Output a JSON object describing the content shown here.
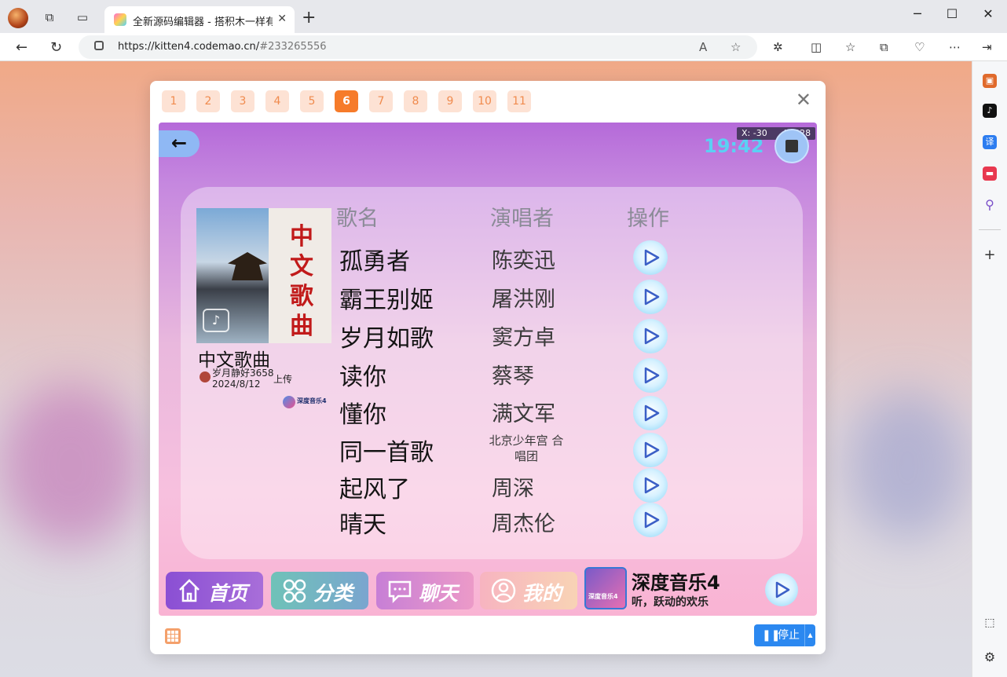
{
  "browser": {
    "tab_title": "全新源码编辑器 - 搭积木一样有趣",
    "tab_close": "✕",
    "new_tab": "+",
    "url_host": "https://kitten4.codemao.cn/",
    "url_hash": "#233265556",
    "icons": [
      "profile-icon",
      "workspaces-icon",
      "tab-actions-icon",
      "back-icon",
      "refresh-icon",
      "lock-icon",
      "read-aloud-icon",
      "favorite-icon",
      "extensions-icon",
      "split-screen-icon",
      "favorites-icon",
      "collections-icon",
      "performance-icon",
      "more-icon",
      "sidebar-toggle-icon"
    ]
  },
  "sidebar": {
    "icons": [
      "toolbox-icon",
      "tiktok-icon",
      "translate-icon",
      "app-icon",
      "search-icon",
      "add-icon",
      "screenshot-icon",
      "settings-icon"
    ],
    "translate_label": "译"
  },
  "modal": {
    "screens": [
      "1",
      "2",
      "3",
      "4",
      "5",
      "6",
      "7",
      "8",
      "9",
      "10",
      "11"
    ],
    "active_screen": "6",
    "close": "✕"
  },
  "stage": {
    "back_arrow": "←",
    "clock": "19:42",
    "coord_x": "X: -30",
    "coord_y": "Y: 328",
    "album": {
      "cover_text": "中文歌曲",
      "title": "中文歌曲",
      "uploader": "岁月静好3658",
      "date": "2024/8/12",
      "upload_label": "上传",
      "brand": "深度音乐4"
    },
    "headers": {
      "song": "歌名",
      "artist": "演唱者",
      "action": "操作"
    },
    "songs": [
      {
        "title": "孤勇者",
        "artist": "陈奕迅"
      },
      {
        "title": "霸王别姬",
        "artist": "屠洪刚"
      },
      {
        "title": "岁月如歌",
        "artist": "窦方卓"
      },
      {
        "title": "读你",
        "artist": "蔡琴"
      },
      {
        "title": "懂你",
        "artist": "满文军"
      },
      {
        "title": "同一首歌",
        "artist": "北京少年宫 合唱团"
      },
      {
        "title": "起风了",
        "artist": "周深"
      },
      {
        "title": "晴天",
        "artist": "周杰伦"
      }
    ],
    "nav": {
      "home": "首页",
      "category": "分类",
      "chat": "聊天",
      "mine": "我的"
    },
    "player": {
      "cover_label": "深度音乐4",
      "title": "深度音乐4",
      "subtitle": "听，跃动的欢乐"
    }
  },
  "footer": {
    "stop_label": "停止",
    "stop_icon": "❚❚"
  },
  "colors": {
    "accent": "#f67b2a",
    "stop_blue": "#2b88f0",
    "clock": "#5bd0f4"
  }
}
